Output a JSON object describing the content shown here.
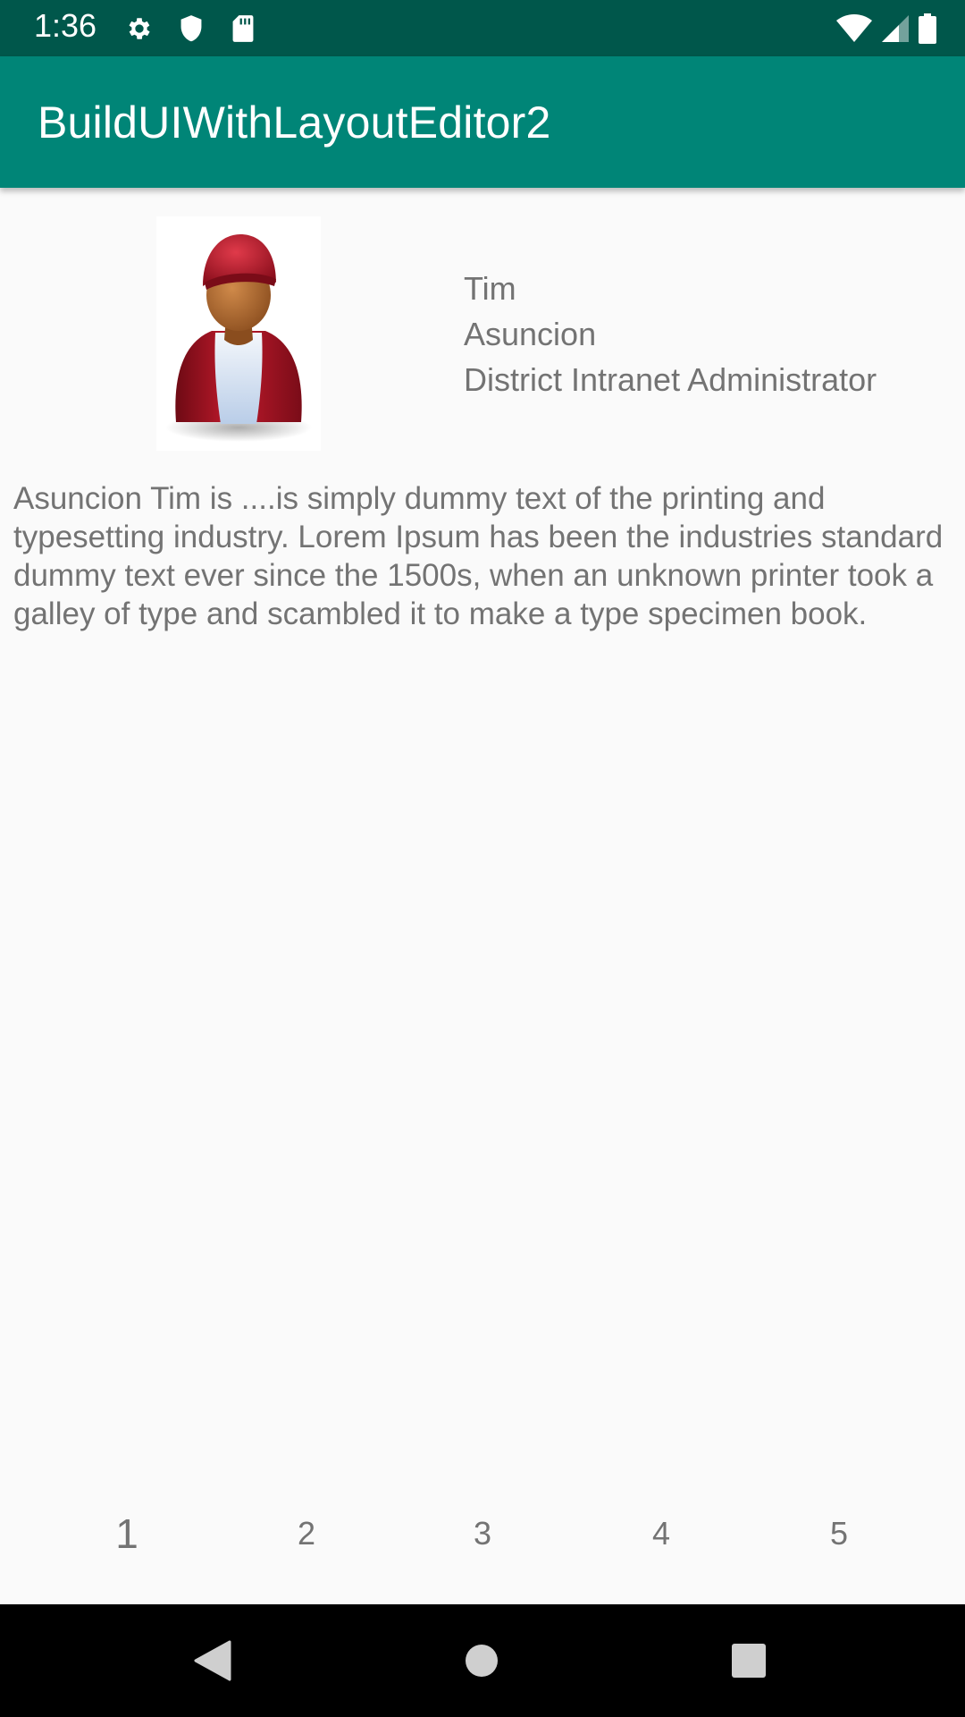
{
  "status_bar": {
    "time": "1:36",
    "icons_left": [
      "gear-icon",
      "shield-icon",
      "sd-card-icon"
    ],
    "icons_right": [
      "wifi-icon",
      "cell-signal-icon",
      "battery-icon"
    ]
  },
  "app_bar": {
    "title": "BuildUIWithLayoutEditor2"
  },
  "profile": {
    "first_name": "Tim",
    "last_name": "Asuncion",
    "role": "District Intranet Administrator",
    "bio": "Asuncion Tim is ....is simply dummy text of the printing and typesetting industry. Lorem Ipsum has been the industries standard dummy text ever since the 1500s, when an unknown printer took a galley of type and scambled it to make a type specimen book."
  },
  "pager": {
    "pages": [
      "1",
      "2",
      "3",
      "4",
      "5"
    ],
    "selected": "1"
  },
  "nav_bar": {
    "buttons": [
      "back-icon",
      "home-icon",
      "recents-icon"
    ]
  },
  "colors": {
    "status_bar": "#00574b",
    "app_bar": "#008577",
    "text_gray": "#737373",
    "background": "#fafafa"
  }
}
